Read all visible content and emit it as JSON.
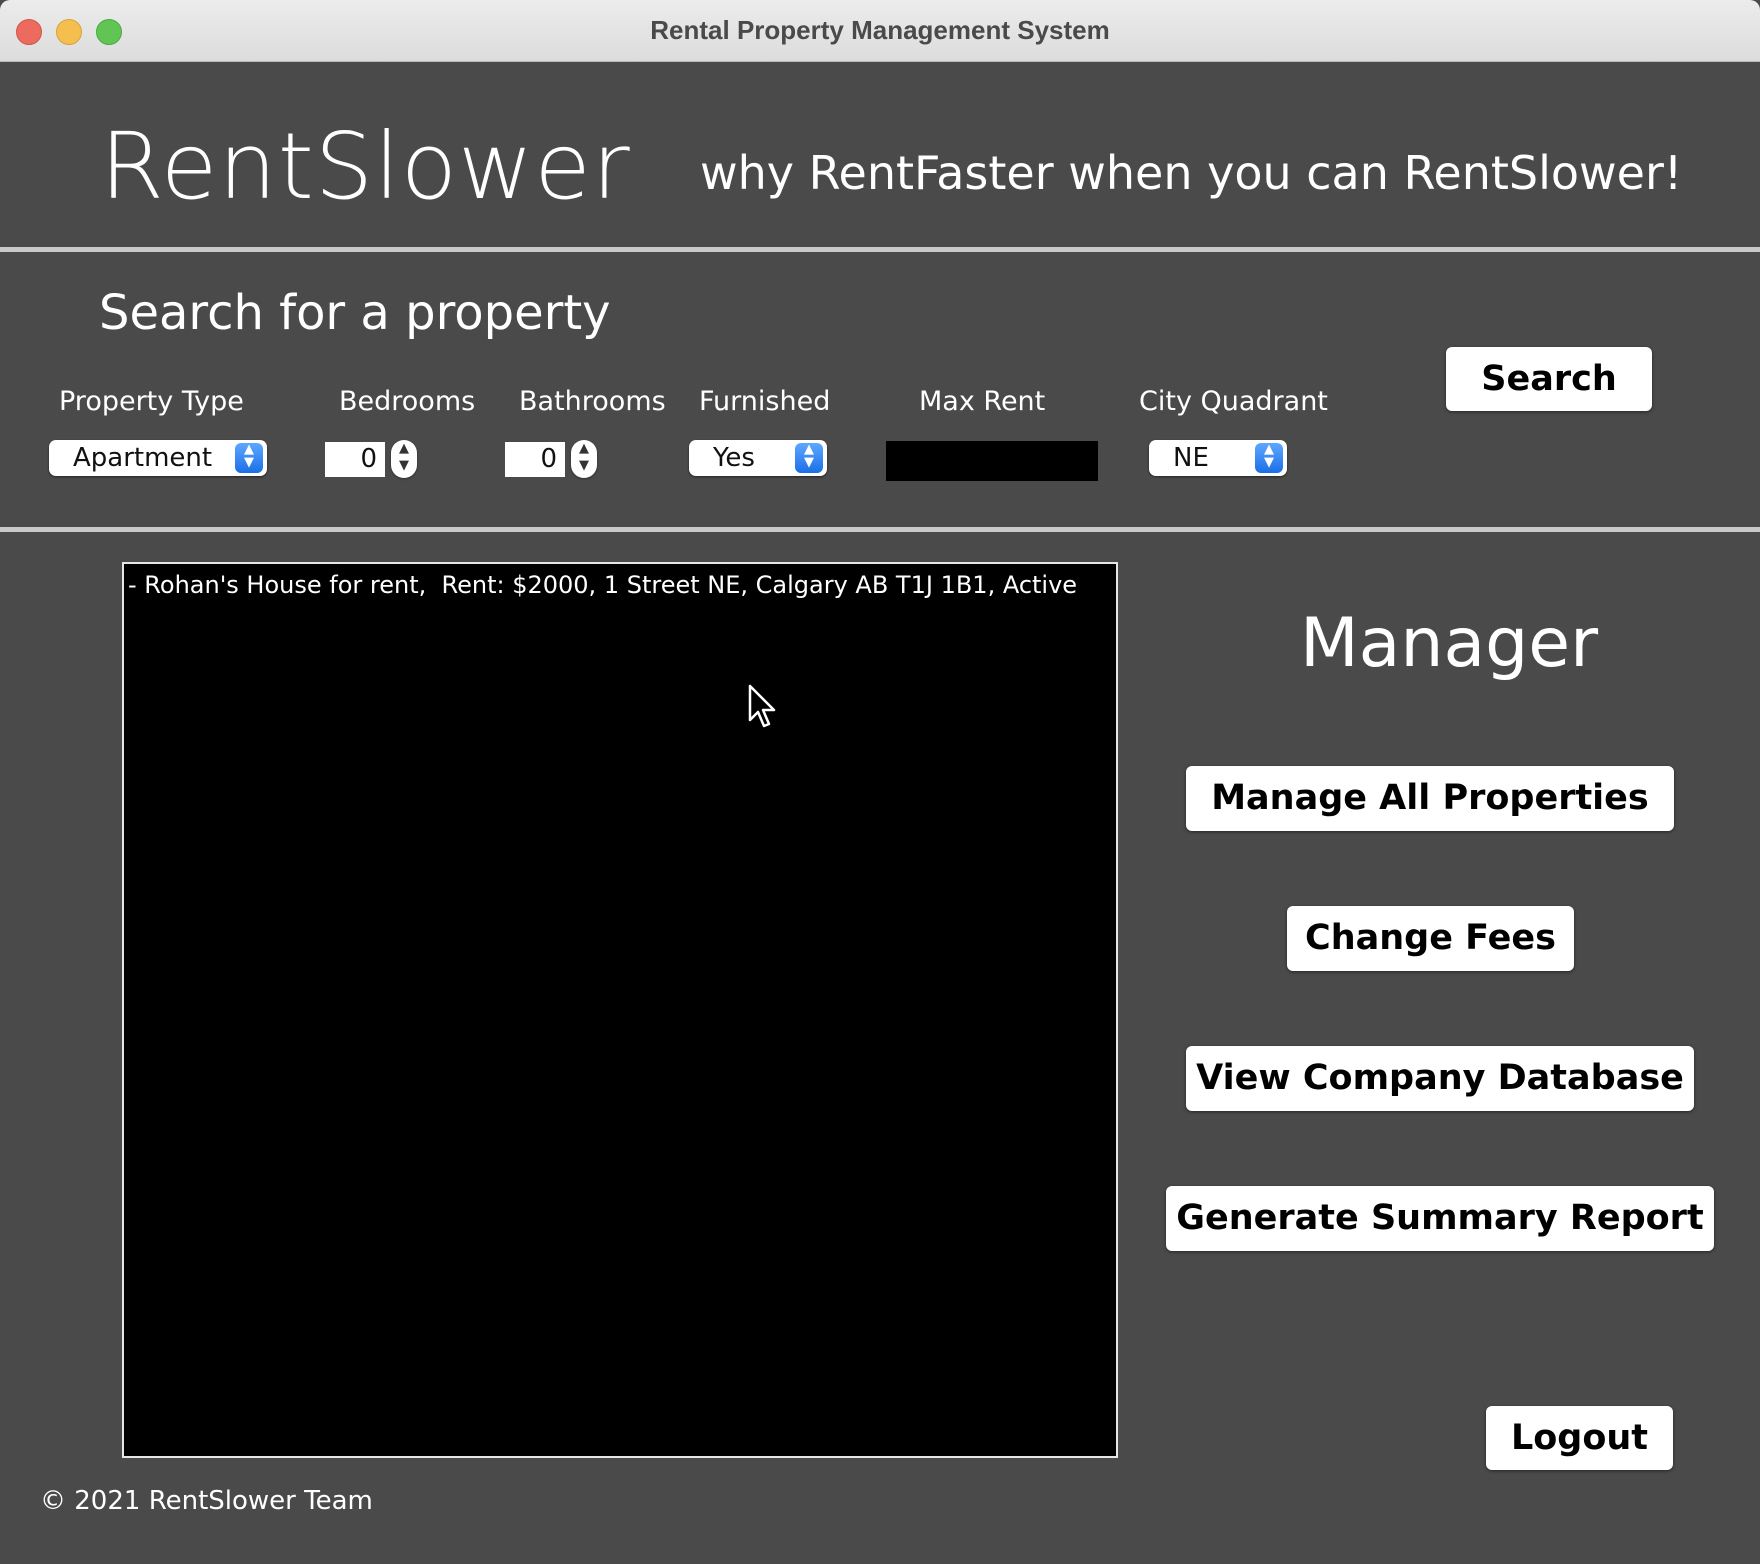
{
  "window": {
    "title": "Rental Property Management System"
  },
  "header": {
    "brand": "RentSlower",
    "tagline": "why RentFaster when you can RentSlower!"
  },
  "search": {
    "title": "Search for a property",
    "property_type": {
      "label": "Property Type",
      "value": "Apartment"
    },
    "bedrooms": {
      "label": "Bedrooms",
      "value": "0"
    },
    "bathrooms": {
      "label": "Bathrooms",
      "value": "0"
    },
    "furnished": {
      "label": "Furnished",
      "value": "Yes"
    },
    "max_rent": {
      "label": "Max Rent",
      "value": ""
    },
    "city_quadrant": {
      "label": "City Quadrant",
      "value": "NE"
    },
    "search_button": "Search"
  },
  "results": {
    "items": [
      "- Rohan's House for rent,  Rent: $2000, 1 Street NE, Calgary AB T1J 1B1, Active"
    ]
  },
  "manager": {
    "title": "Manager",
    "manage_all_properties": "Manage All Properties",
    "change_fees": "Change Fees",
    "view_company_database": "View Company Database",
    "generate_summary_report": "Generate Summary Report",
    "logout": "Logout"
  },
  "footer": {
    "copyright": "© 2021 RentSlower Team"
  },
  "icons": {
    "stepper_up": "▲",
    "stepper_down": "▼",
    "select_arrows": "updown-chevron-icon",
    "cursor": "arrow-cursor-icon"
  },
  "colors": {
    "window_bg": "#4a4a4b",
    "results_bg": "#000000",
    "select_accent": "#1a6fe8"
  }
}
